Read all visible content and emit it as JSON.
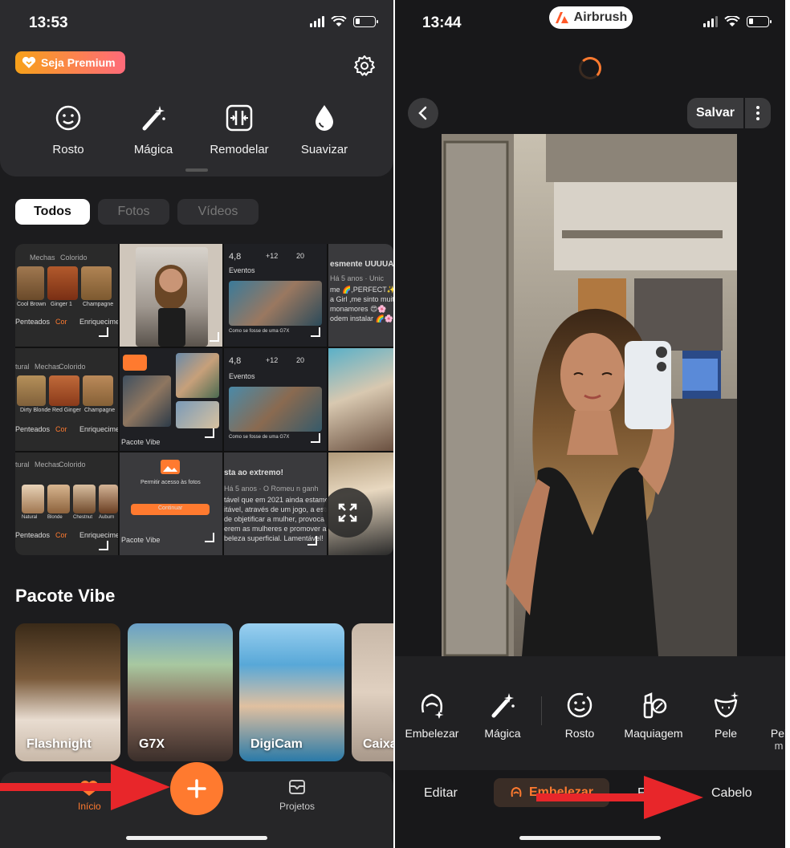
{
  "left": {
    "status": {
      "time": "13:53"
    },
    "premium_label": "Seja Premium",
    "tools": [
      {
        "icon": "face-icon",
        "label": "Rosto"
      },
      {
        "icon": "magic-wand-icon",
        "label": "Mágica"
      },
      {
        "icon": "reshape-icon",
        "label": "Remodelar"
      },
      {
        "icon": "drop-icon",
        "label": "Suavizar"
      }
    ],
    "filters": [
      "Todos",
      "Fotos",
      "Vídeos"
    ],
    "grid": {
      "hair_row_top": [
        "Mechas",
        "Colorido"
      ],
      "hair_swatches": [
        "Cool Brown",
        "Ginger 1",
        "Champagne"
      ],
      "hair_swatches_2": [
        "Dirty Blonde",
        "Red Ginger",
        "Champagne"
      ],
      "hair_menu": [
        "Penteados",
        "Cor",
        "Enriquecimen"
      ],
      "hair_menu_2": [
        "Penteados",
        "Cor",
        "Enriquecimento"
      ],
      "hair_row_top_2": [
        "tural",
        "Mechas",
        "Colorido"
      ],
      "hair_row_top_3": [
        "tural",
        "Mechas",
        "Colorido"
      ],
      "hair_swatches_3": [
        "Natural",
        "Blonde",
        "Chestnut",
        "Auburn"
      ],
      "review_title": "esmente UUUUAA",
      "review_meta": "Há 5 anos · Unic",
      "review_lines": [
        "me 🌈,PERFECT✨",
        "a Girl ,me sinto muito",
        "monamores 😍🌸",
        "odem instalar 🌈🌸"
      ],
      "stats": [
        "4,8",
        "+12",
        "20"
      ],
      "events_label": "Eventos",
      "event_caption": "Como se fosse de uma G7X",
      "pacote_label": "Pacote Vibe",
      "permission_title": "Permitir acesso às fotos",
      "permission_button": "Continuar",
      "review2_title": "sta ao extremo!",
      "review2_meta": "Há 5 anos · O Romeu n ganh",
      "review2_lines": [
        "tável que em 2021 ainda estamos",
        "itável, através de um jogo, a estrutu",
        "de objetificar a mulher, provoca",
        "erem as mulheres e promover a",
        "beleza superficial. Lamentável!"
      ]
    },
    "section_title": "Pacote Vibe",
    "cards": [
      "Flashnight",
      "G7X",
      "DigiCam",
      "Caixa"
    ],
    "tabs": {
      "home": "Início",
      "projects": "Projetos"
    }
  },
  "right": {
    "status": {
      "time": "13:44"
    },
    "brand": "Airbrush",
    "save_label": "Salvar",
    "tools": [
      {
        "icon": "beautify-icon",
        "label": "Embelezar"
      },
      {
        "icon": "magic-wand-icon",
        "label": "Mágica"
      },
      {
        "icon": "face-icon",
        "label": "Rosto"
      },
      {
        "icon": "makeup-icon",
        "label": "Maquiagem"
      },
      {
        "icon": "skin-icon",
        "label": "Pele"
      },
      {
        "icon": "more-tool-icon",
        "label": "Pel"
      }
    ],
    "tools_overflow_suffix": "m",
    "bottom_tabs": {
      "edit": "Editar",
      "beautify": "Embelezar",
      "filters_partial": "Fi",
      "hair": "Cabelo"
    }
  },
  "colors": {
    "accent": "#ff7a2f",
    "arrow": "#e8262a",
    "premium_start": "#f7a11a",
    "premium_end": "#ff6a7a"
  }
}
